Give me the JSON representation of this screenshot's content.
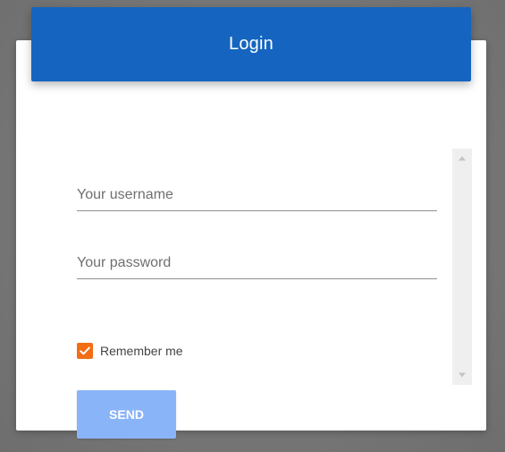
{
  "login_form": {
    "title": "Login",
    "username": {
      "placeholder": "Your username",
      "value": ""
    },
    "password": {
      "placeholder": "Your password",
      "value": ""
    },
    "remember_me": {
      "label": "Remember me",
      "checked": true
    },
    "submit_label": "SEND"
  },
  "colors": {
    "header": "#1565c0",
    "button": "#8ab4f8",
    "checkbox": "#f26d14",
    "scrollbar": "#efefef"
  },
  "icons": {
    "checkbox": "check-icon",
    "scroll_up": "chevron-up-icon",
    "scroll_down": "chevron-down-icon"
  }
}
